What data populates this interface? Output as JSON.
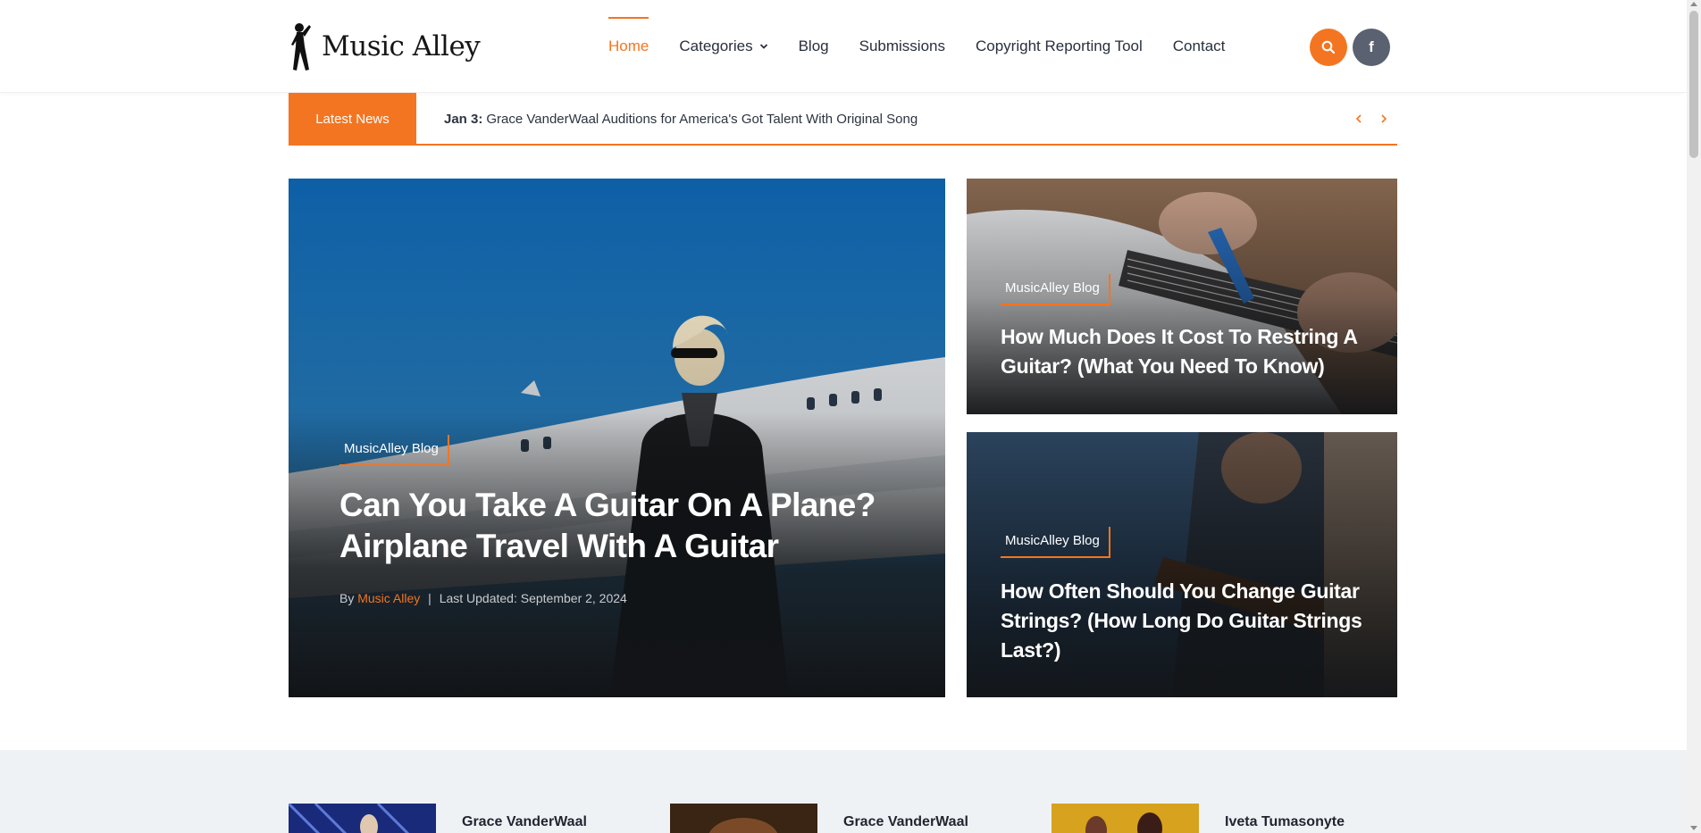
{
  "brand": {
    "name": "Music Alley",
    "accent_color": "#f47521",
    "logo_icon": "dancer-silhouette-icon"
  },
  "nav": {
    "items": [
      {
        "label": "Home",
        "active": true
      },
      {
        "label": "Categories",
        "has_dropdown": true
      },
      {
        "label": "Blog"
      },
      {
        "label": "Submissions"
      },
      {
        "label": "Copyright Reporting Tool"
      },
      {
        "label": "Contact"
      }
    ],
    "search_icon": "search-icon",
    "social_icon": "facebook-icon",
    "social_glyph": "f"
  },
  "ticker": {
    "label": "Latest News",
    "date": "Jan 3:",
    "headline": "Grace VanderWaal Auditions for America's Got Talent With Original Song",
    "prev_icon": "chevron-left-icon",
    "next_icon": "chevron-right-icon"
  },
  "hero": {
    "main": {
      "category": "MusicAlley Blog",
      "title_line1": "Can You Take A Guitar On A Plane?",
      "title_line2": "Airplane Travel With A Guitar",
      "by": "By",
      "author": "Music Alley",
      "separator": "|",
      "updated": "Last Updated: September 2, 2024"
    },
    "side": [
      {
        "category": "MusicAlley Blog",
        "title_line1": "How Much Does It Cost To Restring A",
        "title_line2": "Guitar? (What You Need To Know)"
      },
      {
        "category": "MusicAlley Blog",
        "title_line1": "How Often Should You Change Guitar",
        "title_line2": "Strings? (How Long Do Guitar Strings",
        "title_line3": "Last?)"
      }
    ]
  },
  "recent_posts": [
    {
      "title": "Grace VanderWaal"
    },
    {
      "title": "Grace VanderWaal"
    },
    {
      "title": "Iveta Tumasonyte"
    }
  ]
}
